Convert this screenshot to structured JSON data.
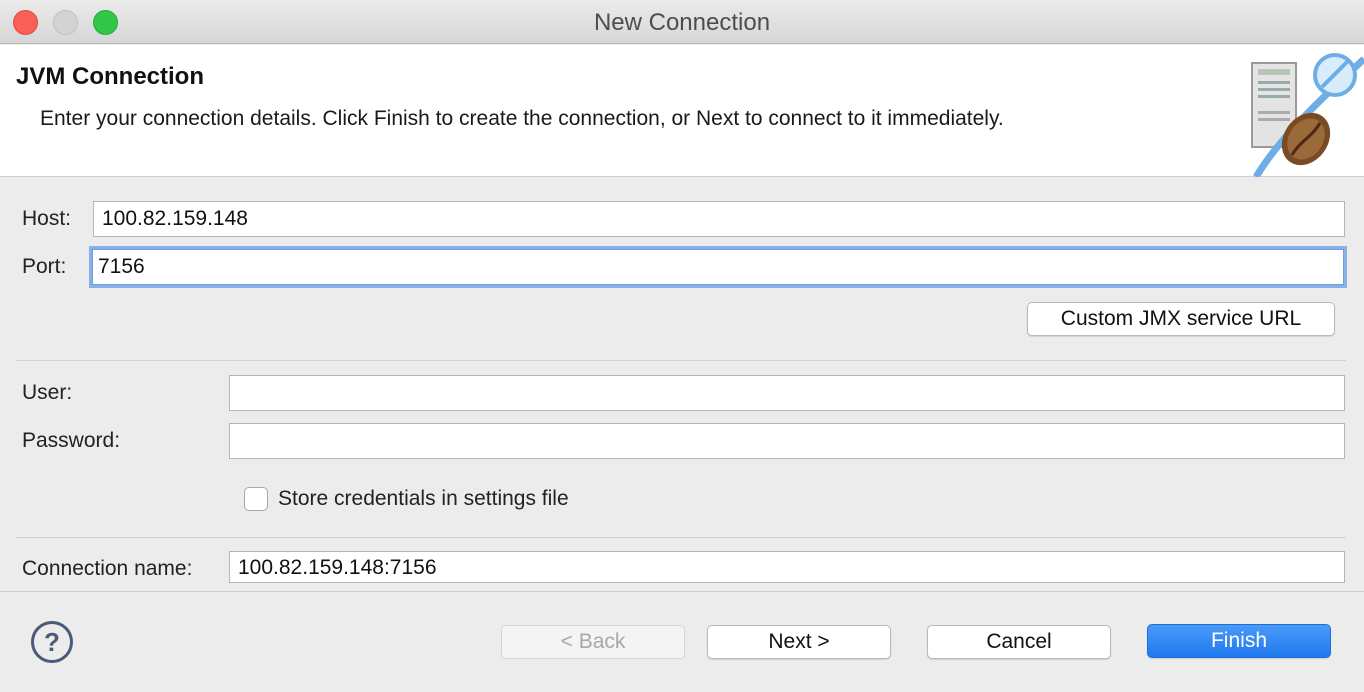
{
  "window": {
    "title": "New Connection"
  },
  "header": {
    "title": "JVM Connection",
    "description": "Enter your connection details. Click Finish to create the connection, or Next to connect to it immediately.",
    "graphic_icon": "jvm-server-connection-icon"
  },
  "form": {
    "host_label": "Host:",
    "host_value": "100.82.159.148",
    "port_label": "Port:",
    "port_value": "7156",
    "custom_jmx_button": "Custom JMX service URL",
    "user_label": "User:",
    "user_value": "",
    "password_label": "Password:",
    "password_value": "",
    "store_credentials_label": "Store credentials in settings file",
    "store_credentials_checked": false,
    "connection_name_label": "Connection name:",
    "connection_name_value": "100.82.159.148:7156"
  },
  "footer": {
    "help_icon": "question-mark-icon",
    "back_label": "< Back",
    "next_label": "Next >",
    "cancel_label": "Cancel",
    "finish_label": "Finish"
  },
  "colors": {
    "primary_button": "#1f78ee",
    "focus_ring": "#8ab0e8",
    "close": "#fc5f57",
    "maximize": "#33c748"
  }
}
